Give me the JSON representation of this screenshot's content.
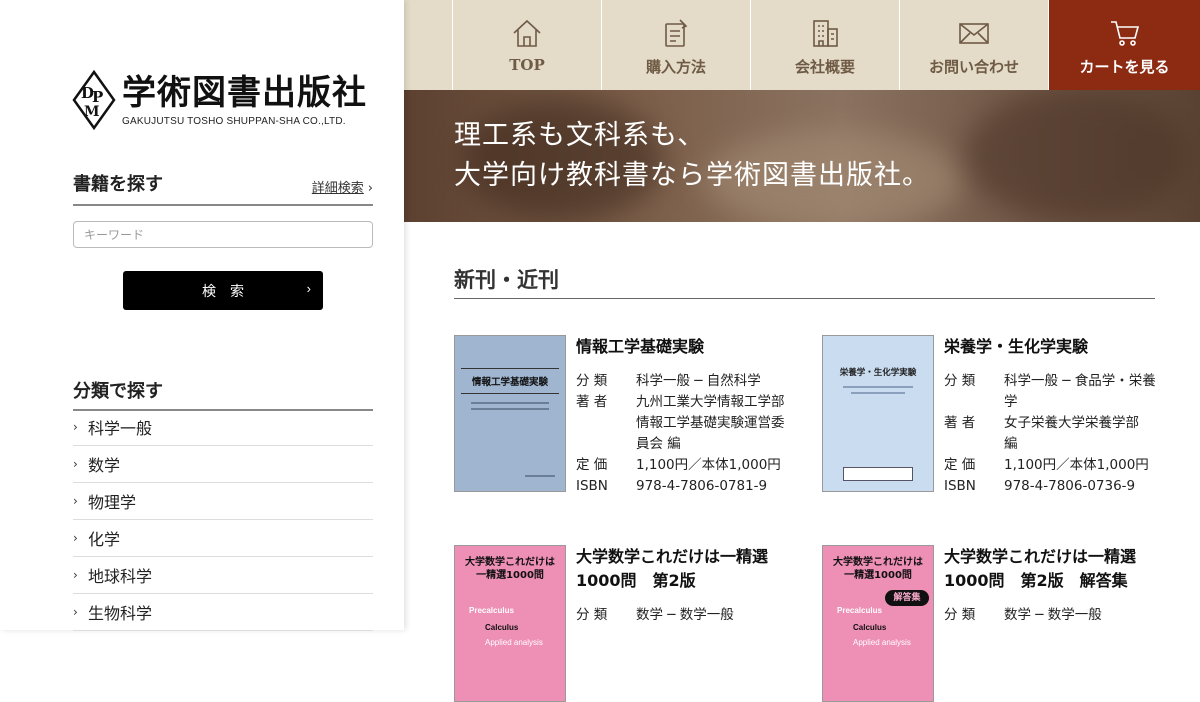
{
  "brand": {
    "name_jp": "学術図書出版社",
    "name_en": "GAKUJUTSU TOSHO SHUPPAN-SHA CO.,LTD."
  },
  "search": {
    "title": "書籍を探す",
    "advanced_label": "詳細検索",
    "placeholder": "キーワード",
    "button_label": "検索",
    "button_arrow": "›"
  },
  "categories": {
    "title": "分類で探す",
    "items": [
      "科学一般",
      "数学",
      "物理学",
      "化学",
      "地球科学",
      "生物科学"
    ]
  },
  "nav": {
    "items": [
      {
        "label": "TOP",
        "icon": "home-icon"
      },
      {
        "label": "購入方法",
        "icon": "document-hand-icon"
      },
      {
        "label": "会社概要",
        "icon": "building-icon"
      },
      {
        "label": "お問い合わせ",
        "icon": "envelope-icon"
      },
      {
        "label": "カートを見る",
        "icon": "cart-icon"
      }
    ]
  },
  "hero": {
    "line1": "理工系も文科系も、",
    "line2": "大学向け教科書なら学術図書出版社。"
  },
  "new_releases": {
    "title": "新刊・近刊",
    "labels": {
      "category": "分 類",
      "author": "著 者",
      "price": "定 価",
      "isbn": "ISBN"
    },
    "books": [
      {
        "title": "情報工学基礎実験",
        "category": "科学一般 ─ 自然科学",
        "author": "九州工業大学情報工学部情報工学基礎実験運営委員会 編",
        "price": "1,100円／本体1,000円",
        "isbn": "978-4-7806-0781-9",
        "cover_title": "情報工学基礎実験",
        "cover_color": "#9fb5d0"
      },
      {
        "title": "栄養学・生化学実験",
        "category": "科学一般 ─ 食品学・栄養学",
        "author": "女子栄養大学栄養学部 編",
        "price": "1,100円／本体1,000円",
        "isbn": "978-4-7806-0736-9",
        "cover_title": "栄養学・生化学実験",
        "cover_color": "#c9dcf0"
      },
      {
        "title": "大学数学これだけは一精選1000問　第2版",
        "category": "数学 ─ 数学一般",
        "cover_title": "大学数学これだけは 一精選1000問",
        "cover_color": "#ee8fb5",
        "cover_words": [
          "Precalculus",
          "Calculus",
          "Applied analysis"
        ]
      },
      {
        "title": "大学数学これだけは一精選1000問　第2版　解答集",
        "category": "数学 ─ 数学一般",
        "cover_title": "大学数学これだけは 一精選1000問",
        "cover_color": "#ee8fb5",
        "cover_badge": "解答集",
        "cover_words": [
          "Precalculus",
          "Calculus",
          "Applied analysis"
        ]
      }
    ]
  }
}
